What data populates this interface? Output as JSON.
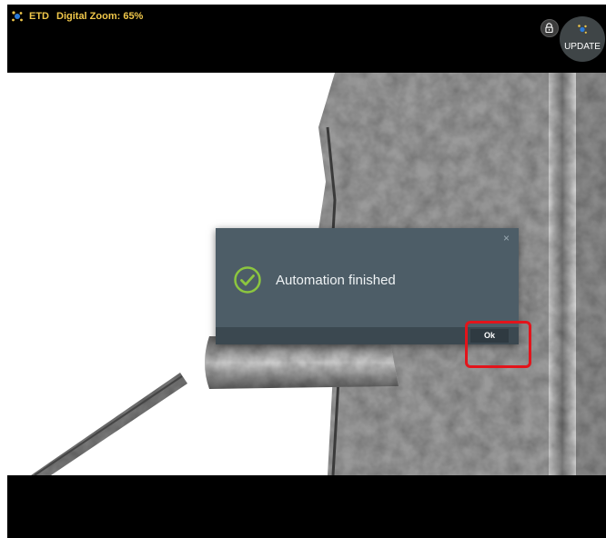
{
  "topbar": {
    "detector": "ETD",
    "zoom_text": "Digital Zoom: 65%",
    "update_label": "UPDATE"
  },
  "dialog": {
    "message": "Automation finished",
    "close_glyph": "×",
    "ok_label": "Ok"
  },
  "colors": {
    "title_text": "#f0c74a",
    "dialog_bg": "#4d5d67",
    "dialog_footer": "#3b4850",
    "success_green": "#8cc63f",
    "highlight_red": "#e3141b"
  },
  "icons": {
    "detector": "detector-icon",
    "lock": "lock-icon",
    "update": "update-icon",
    "success": "check-circle-icon",
    "close": "close-icon"
  }
}
